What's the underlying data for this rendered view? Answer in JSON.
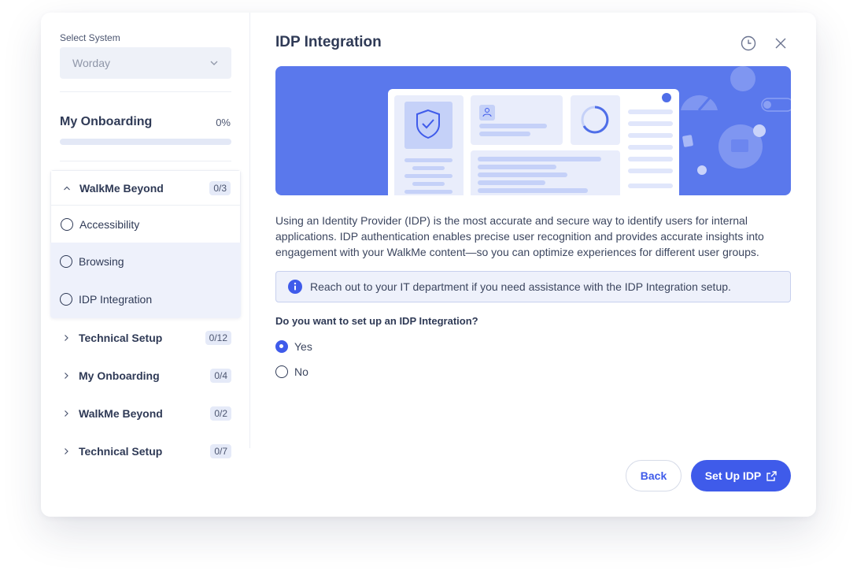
{
  "sidebar": {
    "select_system_label": "Select System",
    "selected_system": "Worday",
    "onboarding_title": "My Onboarding",
    "onboarding_progress": "0%",
    "onboarding_progress_fraction": 0,
    "open_group": {
      "label": "WalkMe Beyond",
      "badge": "0/3",
      "tasks": [
        {
          "label": "Accessibility"
        },
        {
          "label": "Browsing"
        },
        {
          "label": "IDP Integration"
        }
      ]
    },
    "groups": [
      {
        "label": "Technical Setup",
        "badge": "0/12"
      },
      {
        "label": "My Onboarding",
        "badge": "0/4"
      },
      {
        "label": "WalkMe Beyond",
        "badge": "0/2"
      },
      {
        "label": "Technical Setup",
        "badge": "0/7"
      }
    ]
  },
  "main": {
    "title": "IDP Integration",
    "description": "Using an Identity Provider (IDP) is the most accurate and secure way to identify users for internal applications. IDP authentication enables precise user recognition and provides accurate insights into engagement with your WalkMe content—so you can optimize experiences for different user groups.",
    "info_text": "Reach out to your IT department if you need assistance with the IDP Integration setup.",
    "question": "Do you want to set up an IDP Integration?",
    "options": [
      {
        "label": "Yes",
        "selected": true
      },
      {
        "label": "No",
        "selected": false
      }
    ],
    "back_label": "Back",
    "primary_label": "Set Up IDP"
  },
  "colors": {
    "accent": "#3f5bea",
    "hero_bg": "#5a78ec",
    "text": "#2f3a56",
    "tint": "#eef1fb"
  },
  "icons": [
    "chevron-down-icon",
    "chevron-up-icon",
    "chevron-right-icon",
    "history-icon",
    "close-icon",
    "info-icon",
    "external-link-icon",
    "shield-check-icon"
  ]
}
